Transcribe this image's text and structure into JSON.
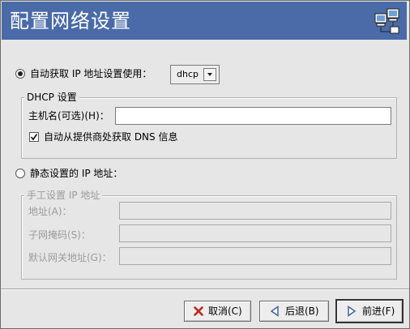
{
  "window": {
    "title": "配置网络设置",
    "icon": "network-computers-icon"
  },
  "auto": {
    "label": "自动获取 IP 地址设置使用：",
    "selected": true,
    "method_value": "dhcp"
  },
  "dhcp_group": {
    "title": "DHCP 设置",
    "hostname_label": "主机名(可选)(H)：",
    "hostname_value": "",
    "dns_checkbox_label": "自动从提供商处获取 DNS 信息",
    "dns_checked": true
  },
  "static": {
    "label": "静态设置的 IP 地址：",
    "selected": false
  },
  "manual_group": {
    "title": "手工设置 IP 地址",
    "address_label": "地址(A)：",
    "address_value": "",
    "netmask_label": "子网掩码(S)：",
    "netmask_value": "",
    "gateway_label": "默认网关地址(G)：",
    "gateway_value": ""
  },
  "buttons": {
    "cancel": "取消(C)",
    "back": "后退(B)",
    "forward": "前进(F)"
  },
  "colors": {
    "titlebar": "#4a6ba8",
    "window_bg": "#e6e6e6",
    "cancel_icon": "#c0271e",
    "nav_icon": "#3a5a9e"
  }
}
